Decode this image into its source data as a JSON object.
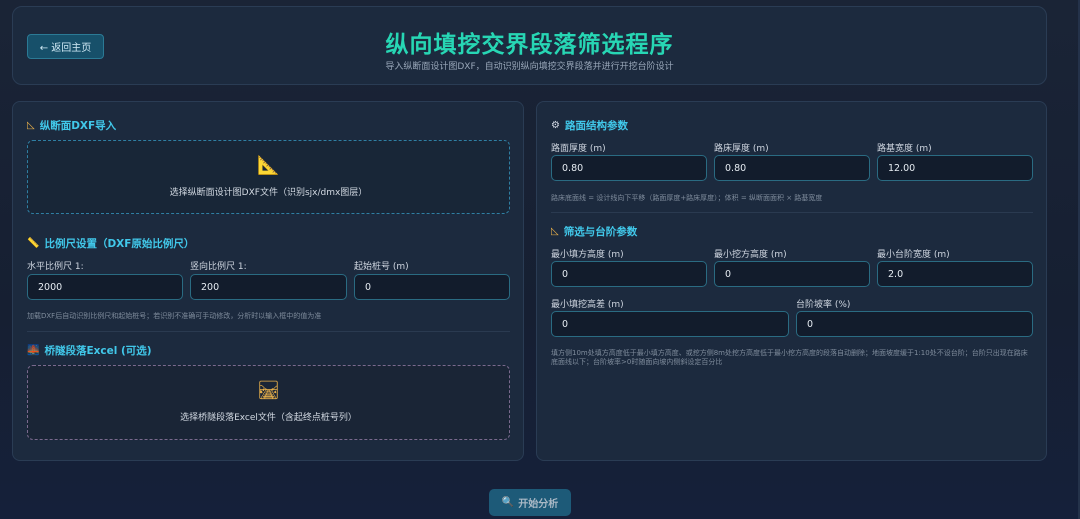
{
  "header": {
    "back_label": "← 返回主页",
    "title": "纵向填挖交界段落筛选程序",
    "subtitle": "导入纵断面设计图DXF，自动识别纵向填挖交界段落并进行开挖台阶设计"
  },
  "left": {
    "dxf": {
      "title": "纵断面DXF导入",
      "icon": "triangle-ruler-icon",
      "drop_text": "选择纵断面设计图DXF文件（识别sjx/dmx图层）"
    },
    "scale": {
      "title": "比例尺设置（DXF原始比例尺）",
      "icon": "ruler-icon",
      "fields": [
        {
          "label": "水平比例尺 1:",
          "value": "2000"
        },
        {
          "label": "竖向比例尺 1:",
          "value": "200"
        },
        {
          "label": "起始桩号 (m)",
          "value": "0"
        }
      ],
      "hint": "加载DXF后自动识别比例尺和起始桩号；若识别不准确可手动修改，分析时以输入框中的值为准"
    },
    "bridge": {
      "title": "桥隧段落Excel (可选)",
      "icon": "bridge-icon",
      "drop_text": "选择桥隧段落Excel文件（含起终点桩号列）"
    }
  },
  "right": {
    "road": {
      "title": "路面结构参数",
      "icon": "gear-icon",
      "fields": [
        {
          "label": "路面厚度 (m)",
          "value": "0.80"
        },
        {
          "label": "路床厚度 (m)",
          "value": "0.80"
        },
        {
          "label": "路基宽度 (m)",
          "value": "12.00"
        }
      ],
      "hint": "路床底面线 = 设计线向下平移（路面厚度+路床厚度）；体积 = 纵断面面积 × 路基宽度"
    },
    "filter": {
      "title": "筛选与台阶参数",
      "icon": "triangle-ruler-icon",
      "fields": [
        {
          "label": "最小填方高度 (m)",
          "value": "0"
        },
        {
          "label": "最小挖方高度 (m)",
          "value": "0"
        },
        {
          "label": "最小台阶宽度 (m)",
          "value": "2.0"
        },
        {
          "label": "最小填挖高差 (m)",
          "value": "0"
        },
        {
          "label": "台阶坡率 (%)",
          "value": "0"
        }
      ],
      "hint1": "填方侧10m处填方高度低于最小填方高度、或挖方侧8m处挖方高度低于最小挖方高度的段落自动删除；地面坡度缓于1:10处不设台阶；台阶只出现在路床",
      "hint2": "底面线以下；台阶坡率>0时随面向坡内侧斜设定百分比"
    }
  },
  "actions": {
    "start_label": "开始分析",
    "start_icon": "search-icon"
  },
  "colors": {
    "accent_title": "#27d6b4",
    "section_title": "#41c8ea",
    "input_border": "#2a6b82",
    "panel_bg": "#1c2a3e"
  }
}
